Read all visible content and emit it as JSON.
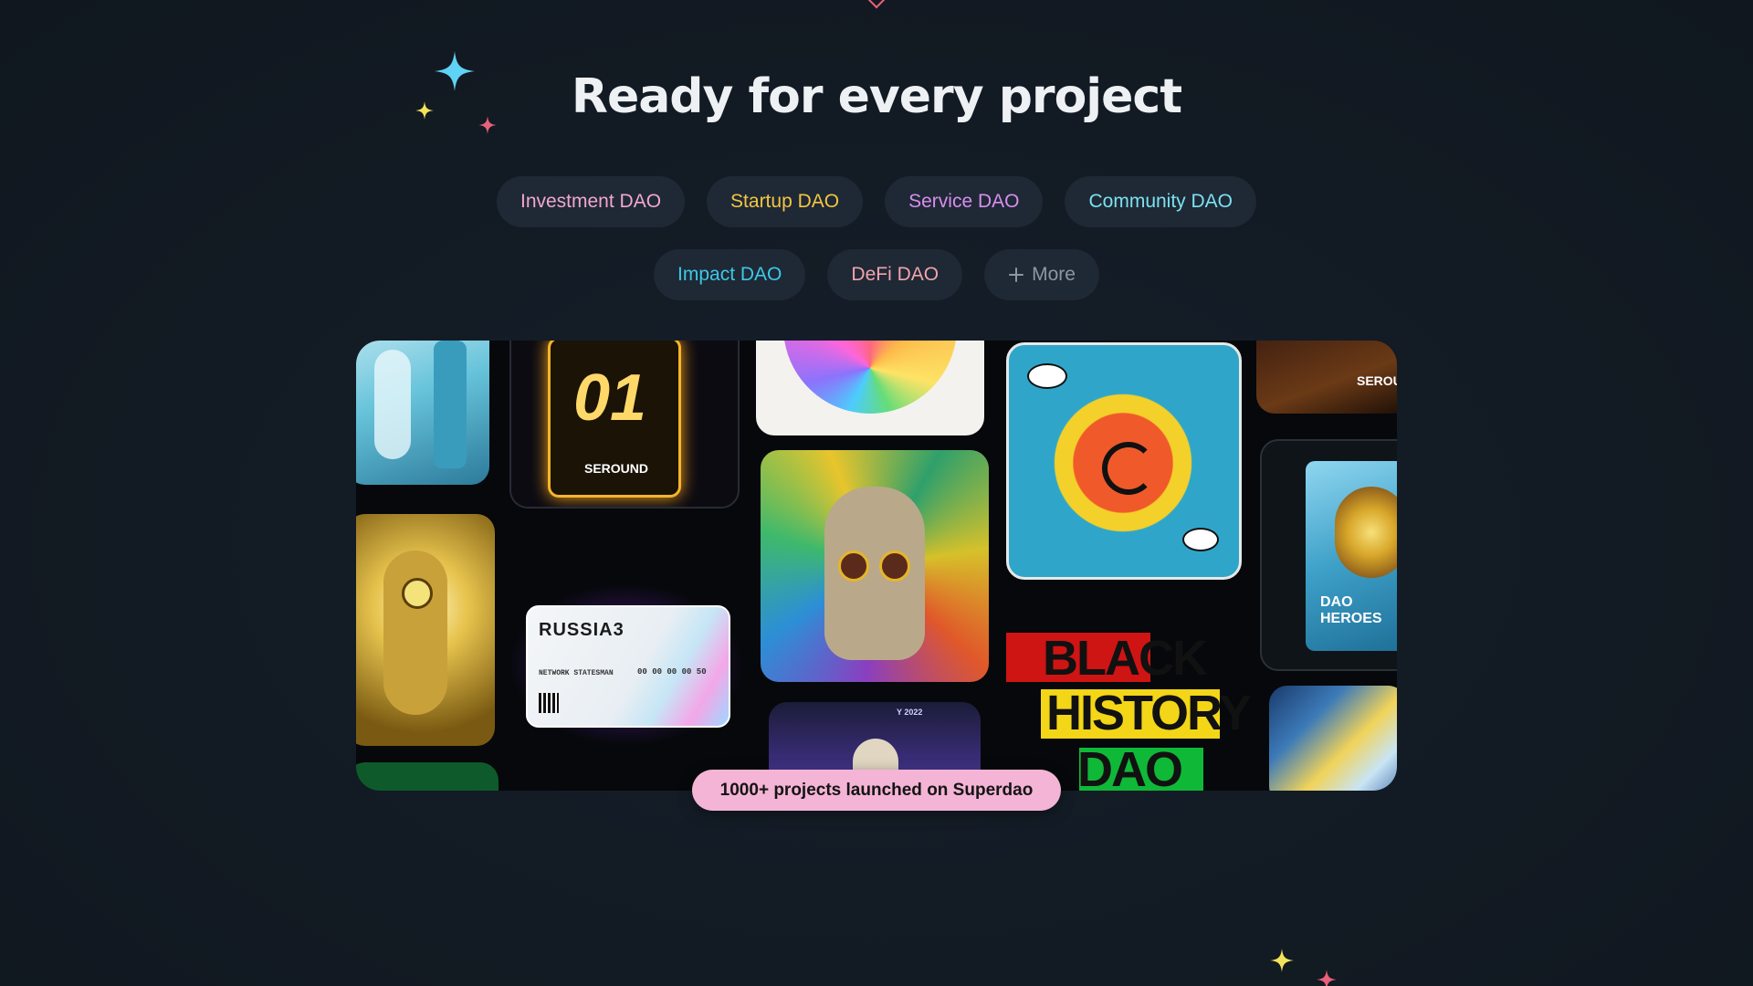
{
  "heading": "Ready for every project",
  "chips": [
    {
      "label": "Investment DAO",
      "color": "#f2a6d0"
    },
    {
      "label": "Startup DAO",
      "color": "#f5c542"
    },
    {
      "label": "Service DAO",
      "color": "#d98df0"
    },
    {
      "label": "Community DAO",
      "color": "#7de0f0"
    },
    {
      "label": "Impact DAO",
      "color": "#3ec8e8"
    },
    {
      "label": "DeFi DAO",
      "color": "#f3a3ae"
    },
    {
      "label": "More",
      "color": "#8c97a3",
      "icon": "plus-icon"
    }
  ],
  "gallery": {
    "tiles": {
      "serotonin_number": "01",
      "serotonin_label": "SEROUND",
      "serotonin_label_small": "SEROU",
      "russia_title": "RUSSIA3",
      "russia_sub": "NETWORK STATESMAN",
      "russia_digits": "00 00 00 00 50",
      "black_history_lines": [
        "BLACK",
        "HISTORY",
        "DAO"
      ],
      "dao_heroes": [
        "DAO",
        "HEROES"
      ],
      "video_date": "Y 2022"
    },
    "badge": "1000+ projects launched on Superdao"
  },
  "colors": {
    "background": "#131b24",
    "chip_bg": "#1e2935",
    "heading": "#eef1f4",
    "badge_bg": "#f4b4d6",
    "sparkle_cyan": "#5fd3f5",
    "sparkle_yellow": "#f2e35a",
    "sparkle_pink": "#e8617a"
  }
}
